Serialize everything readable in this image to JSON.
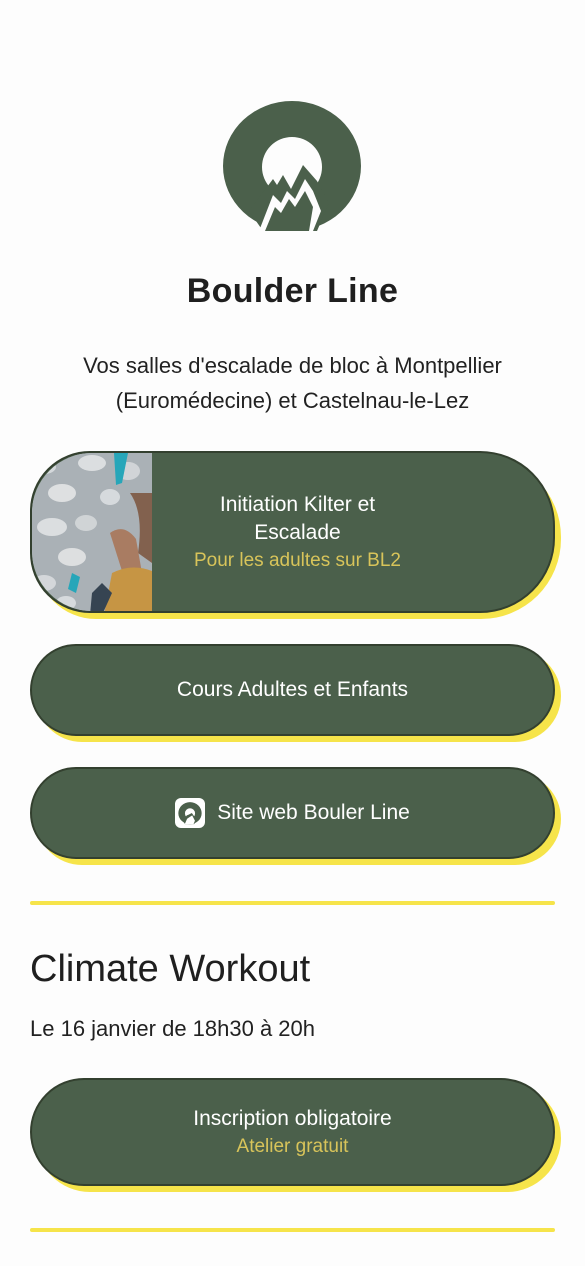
{
  "profile": {
    "title": "Boulder Line",
    "description": "Vos salles d'escalade de bloc à Montpellier (Euromédecine) et Castelnau-le-Lez"
  },
  "links": [
    {
      "label": "Initiation Kilter et Escalade",
      "sublabel": "Pour les adultes sur BL2",
      "thumbnail": "climbing-wall-photo"
    },
    {
      "label": "Cours Adultes et Enfants"
    },
    {
      "label": "Site web Bouler Line",
      "icon": "boulder-line-logo-icon"
    }
  ],
  "event": {
    "title": "Climate Workout",
    "date": "Le 16 janvier de 18h30 à 20h",
    "button_label": "Inscription obligatoire",
    "button_sublabel": "Atelier gratuit"
  },
  "colors": {
    "button_bg": "#4b604b",
    "button_shadow": "#f6e44a",
    "sublabel": "#d8c45a",
    "logo": "#4b604b"
  }
}
